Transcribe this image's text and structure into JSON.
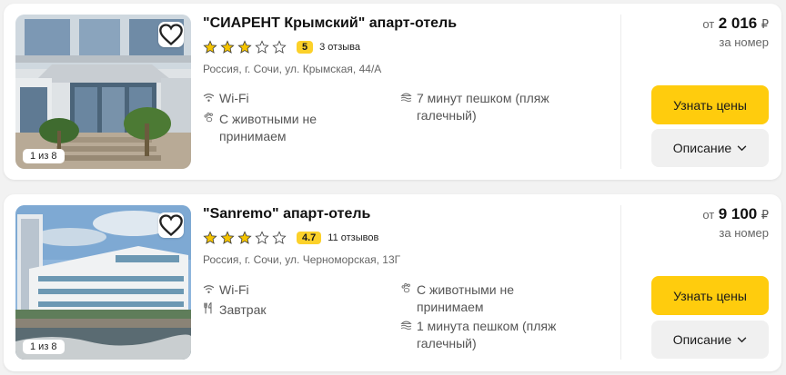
{
  "hotels": [
    {
      "name": "\"СИАРЕНТ Крымский\" апарт-отель",
      "stars": 3,
      "max_stars": 5,
      "score": "5",
      "reviews": "3 отзыва",
      "address": "Россия, г. Сочи, ул. Крымская, 44/А",
      "photo_counter": "1 из 8",
      "amenities_left": [
        {
          "icon": "wifi-icon",
          "text": "Wi-Fi"
        },
        {
          "icon": "paw-icon",
          "text": "С животными не принимаем"
        }
      ],
      "amenities_right": [
        {
          "icon": "beach-icon",
          "text": "7 минут пешком (пляж галечный)"
        }
      ],
      "price_prefix": "от",
      "price": "2 016",
      "currency": "₽",
      "per": "за номер",
      "btn_price": "Узнать цены",
      "btn_desc": "Описание"
    },
    {
      "name": "\"Sanremo\" апарт-отель",
      "stars": 3,
      "max_stars": 5,
      "score": "4.7",
      "reviews": "11 отзывов",
      "address": "Россия, г. Сочи, ул. Черноморская, 13Г",
      "photo_counter": "1 из 8",
      "amenities_left": [
        {
          "icon": "wifi-icon",
          "text": "Wi-Fi"
        },
        {
          "icon": "fork-knife-icon",
          "text": "Завтрак"
        }
      ],
      "amenities_right": [
        {
          "icon": "paw-icon",
          "text": "С животными не принимаем"
        },
        {
          "icon": "beach-icon",
          "text": "1 минута пешком (пляж галечный)"
        }
      ],
      "price_prefix": "от",
      "price": "9 100",
      "currency": "₽",
      "per": "за номер",
      "btn_price": "Узнать цены",
      "btn_desc": "Описание"
    }
  ],
  "colors": {
    "accent_yellow": "#ffcc0d",
    "star_fill": "#f5c400",
    "score_bg": "#fcd12a"
  }
}
